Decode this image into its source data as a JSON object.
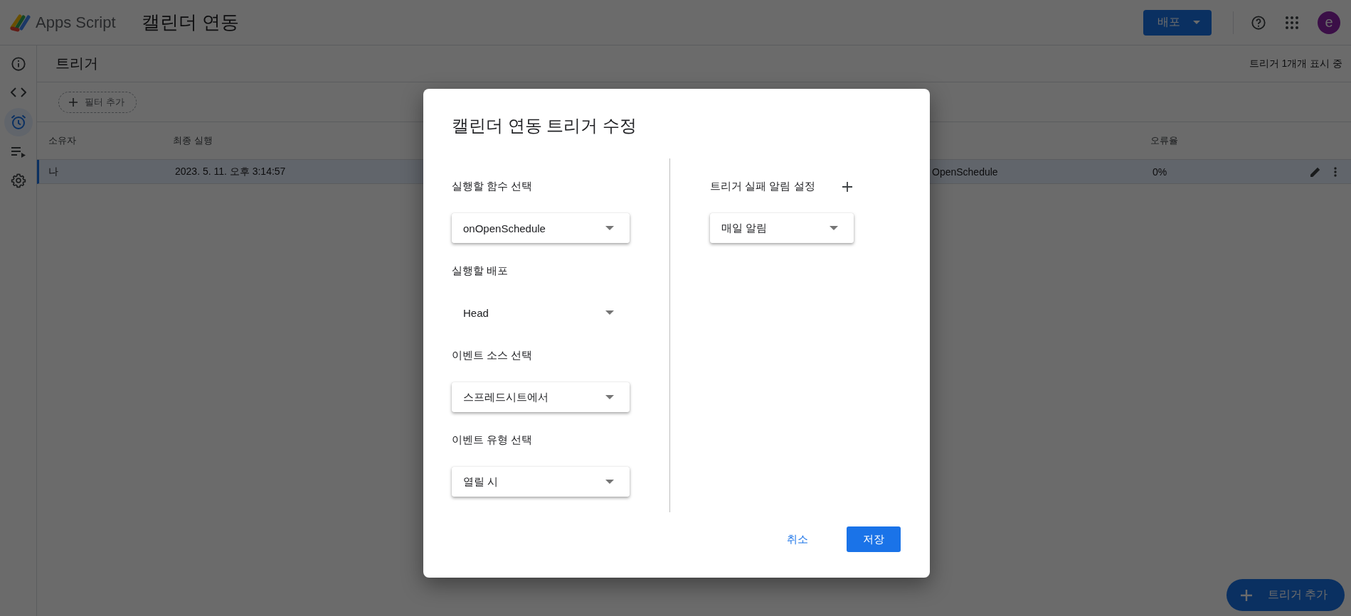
{
  "app": {
    "name": "Apps Script",
    "project": "캘린더 연동",
    "deploy_button": "배포",
    "avatar": "e"
  },
  "rail": [
    {
      "kind": "info",
      "selected": false
    },
    {
      "kind": "code",
      "selected": false
    },
    {
      "kind": "alarm",
      "selected": true
    },
    {
      "kind": "executions",
      "selected": false
    },
    {
      "kind": "settings",
      "selected": false
    }
  ],
  "page": {
    "title": "트리거",
    "count": "트리거 1개개 표시 중",
    "filter_chip": "필터 추가"
  },
  "table": {
    "columns": [
      "소유자",
      "최종 실행",
      "오류율"
    ],
    "rows": [
      {
        "owner": "나",
        "last_run": "2023. 5. 11. 오후 3:14:57",
        "column_3": "OpenSchedule",
        "error_rate": "0%",
        "selected": true
      }
    ]
  },
  "fab": "트리거 추가",
  "dialog": {
    "title": "캘린더 연동 트리거 수정",
    "fields": [
      {
        "label": "실행할 함수 선택",
        "value": "onOpenSchedule",
        "kind": "raised"
      },
      {
        "label": "실행할 배포",
        "value": "Head",
        "kind": "plain"
      },
      {
        "label": "이벤트 소스 선택",
        "value": "스프레드시트에서",
        "kind": "raised"
      },
      {
        "label": "이벤트 유형 선택",
        "value": "열릴 시",
        "kind": "raised"
      }
    ],
    "notification": {
      "label": "트리거 실패 알림 설정",
      "value": "매일 알림"
    },
    "cancel": "취소",
    "save": "저장"
  }
}
